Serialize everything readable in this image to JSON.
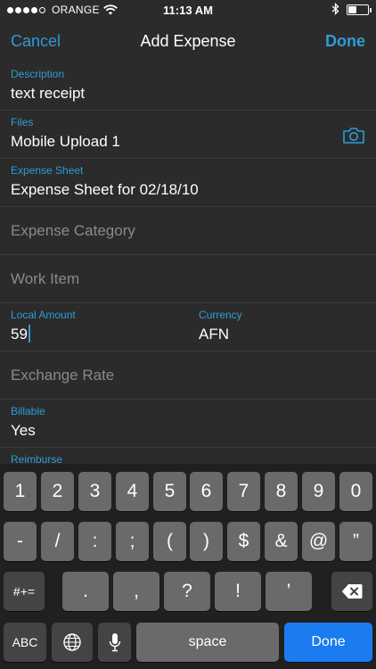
{
  "status_bar": {
    "carrier": "ORANGE",
    "time": "11:13 AM",
    "signal_bars": 4,
    "signal_total": 5,
    "battery_level": 0.45
  },
  "nav": {
    "cancel_label": "Cancel",
    "title": "Add Expense",
    "done_label": "Done"
  },
  "form": {
    "description": {
      "label": "Description",
      "value": "text receipt"
    },
    "files": {
      "label": "Files",
      "value": "Mobile Upload 1",
      "icon": "camera-icon"
    },
    "expense_sheet": {
      "label": "Expense Sheet",
      "value": "Expense Sheet for 02/18/10"
    },
    "expense_category": {
      "placeholder": "Expense Category"
    },
    "work_item": {
      "placeholder": "Work Item"
    },
    "local_amount": {
      "label": "Local Amount",
      "value": "59"
    },
    "currency": {
      "label": "Currency",
      "value": "AFN"
    },
    "exchange_rate": {
      "placeholder": "Exchange Rate"
    },
    "billable": {
      "label": "Billable",
      "value": "Yes"
    },
    "reimburse": {
      "label": "Reimburse"
    }
  },
  "keyboard": {
    "row1": [
      "1",
      "2",
      "3",
      "4",
      "5",
      "6",
      "7",
      "8",
      "9",
      "0"
    ],
    "row2": [
      "-",
      "/",
      ":",
      ";",
      "(",
      ")",
      "$",
      "&",
      "@",
      "”"
    ],
    "row3": [
      ".",
      ",",
      "?",
      "!",
      "’"
    ],
    "symbols_label": "#+=",
    "abc_label": "ABC",
    "space_label": "space",
    "done_label": "Done"
  },
  "colors": {
    "accent": "#2f9bd6",
    "background": "#2b2b2b",
    "keyboard_bg": "#202020",
    "done_key": "#1a7cf0"
  }
}
